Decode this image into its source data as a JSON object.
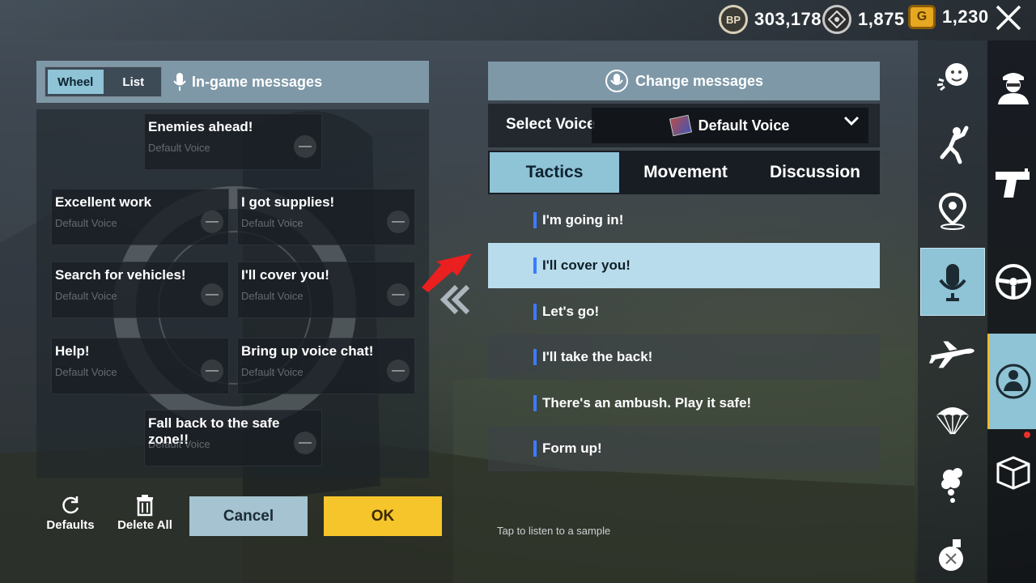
{
  "currency": {
    "bp_icon": "BP",
    "bp_value": "303,178",
    "uc_value": "1,875",
    "g_icon": "G",
    "g_value": "1,230"
  },
  "close_icon": "close-icon",
  "left_panel": {
    "tabs": [
      "Wheel",
      "List"
    ],
    "active_tab": "Wheel",
    "title": "In-game messages",
    "slots": [
      {
        "name": "Enemies ahead!",
        "voice": "Default Voice"
      },
      {
        "name": "Excellent work",
        "voice": "Default Voice"
      },
      {
        "name": "I got supplies!",
        "voice": "Default Voice"
      },
      {
        "name": "Search for vehicles!",
        "voice": "Default Voice"
      },
      {
        "name": "I'll cover you!",
        "voice": "Default Voice"
      },
      {
        "name": "Help!",
        "voice": "Default Voice"
      },
      {
        "name": "Bring up voice chat!",
        "voice": "Default Voice"
      },
      {
        "name": "Fall back to the safe zone!!",
        "voice": "Default Voice"
      }
    ],
    "remove_glyph": "—"
  },
  "actions": {
    "defaults": "Defaults",
    "delete_all": "Delete All",
    "cancel": "Cancel",
    "ok": "OK"
  },
  "right_panel": {
    "title": "Change messages",
    "select_voice_label": "Select Voice",
    "selected_voice": "Default Voice",
    "tabs": [
      "Tactics",
      "Movement",
      "Discussion"
    ],
    "active_tab": "Tactics",
    "messages": [
      "I'm going in!",
      "I'll cover you!",
      "Let's go!",
      "I'll take the back!",
      "There's an ambush. Play it safe!",
      "Form up!"
    ],
    "selected_message": "I'll cover you!",
    "hint": "Tap to listen to a sample"
  },
  "side_nav": [
    "emote-icon",
    "gesture-icon",
    "map-marker-icon",
    "microphone-icon",
    "plane-icon",
    "parachute-icon",
    "smoke-icon",
    "grenade-icon"
  ],
  "side_nav_selected": "microphone-icon",
  "far_nav": [
    "character-icon",
    "gun-icon",
    "steering-wheel-icon",
    "character-outfit-icon",
    "crate-icon"
  ],
  "far_nav_selected": "character-outfit-icon",
  "colors": {
    "accent": "#8fc3d6",
    "ok": "#f5c52b",
    "marker": "#3c7bff",
    "alert": "#e8312a"
  }
}
